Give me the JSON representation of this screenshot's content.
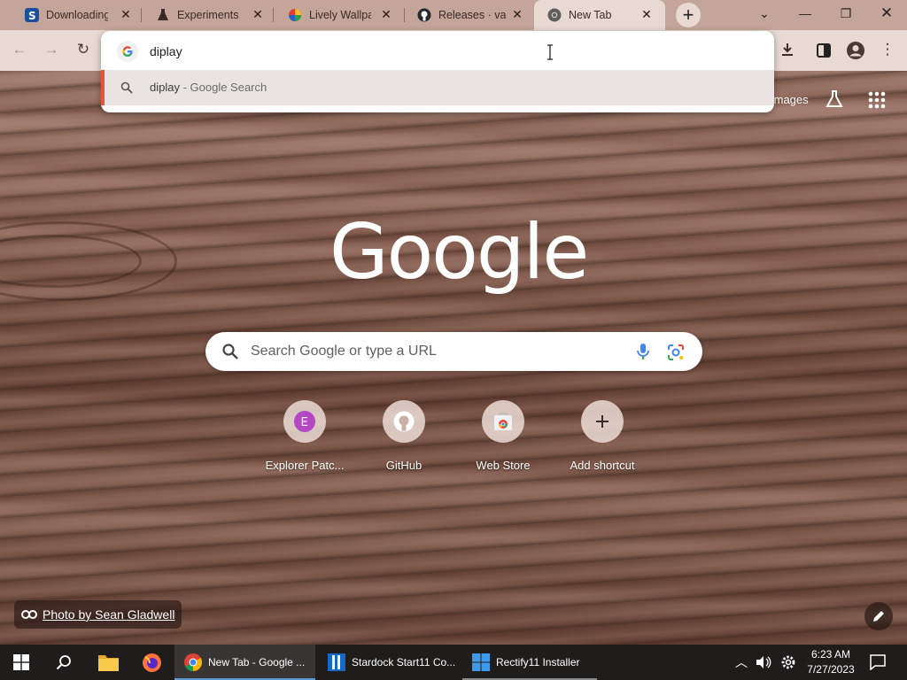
{
  "tabs": [
    {
      "title": "Downloading",
      "favicon": "stardock-icon",
      "active": false
    },
    {
      "title": "Experiments",
      "favicon": "flask-icon",
      "active": false
    },
    {
      "title": "Lively Wallpap",
      "favicon": "lively-icon",
      "active": false
    },
    {
      "title": "Releases · vali",
      "favicon": "github-icon",
      "active": false
    },
    {
      "title": "New Tab",
      "favicon": "chrome-icon",
      "active": true
    }
  ],
  "omnibox": {
    "typed": "diplay",
    "suggestion_query": "diplay",
    "suggestion_suffix": " - Google Search"
  },
  "ntp": {
    "images_link": "Images",
    "logo": "Google",
    "search_placeholder": "Search Google or type a URL",
    "shortcuts": [
      {
        "label": "Explorer Patc...",
        "icon": "letter-e-avatar",
        "letter": "E"
      },
      {
        "label": "GitHub",
        "icon": "github-icon"
      },
      {
        "label": "Web Store",
        "icon": "chrome-web-store-icon"
      },
      {
        "label": "Add shortcut",
        "icon": "plus-icon"
      }
    ],
    "photo_credit": "Photo by Sean Gladwell"
  },
  "taskbar": {
    "apps": [
      {
        "label": "New Tab - Google ...",
        "icon": "chrome-icon",
        "active": true
      },
      {
        "label": "Stardock Start11 Co...",
        "icon": "stardock-start11-icon",
        "active": false
      },
      {
        "label": "Rectify11 Installer",
        "icon": "rectify11-icon",
        "active": false
      }
    ],
    "time": "6:23 AM",
    "date": "7/27/2023"
  },
  "colors": {
    "tabstrip": "#c4a599",
    "toolbar": "#e8d9d3",
    "suggestion_accent": "#e8533c",
    "taskbar": "#1f1c1c"
  }
}
